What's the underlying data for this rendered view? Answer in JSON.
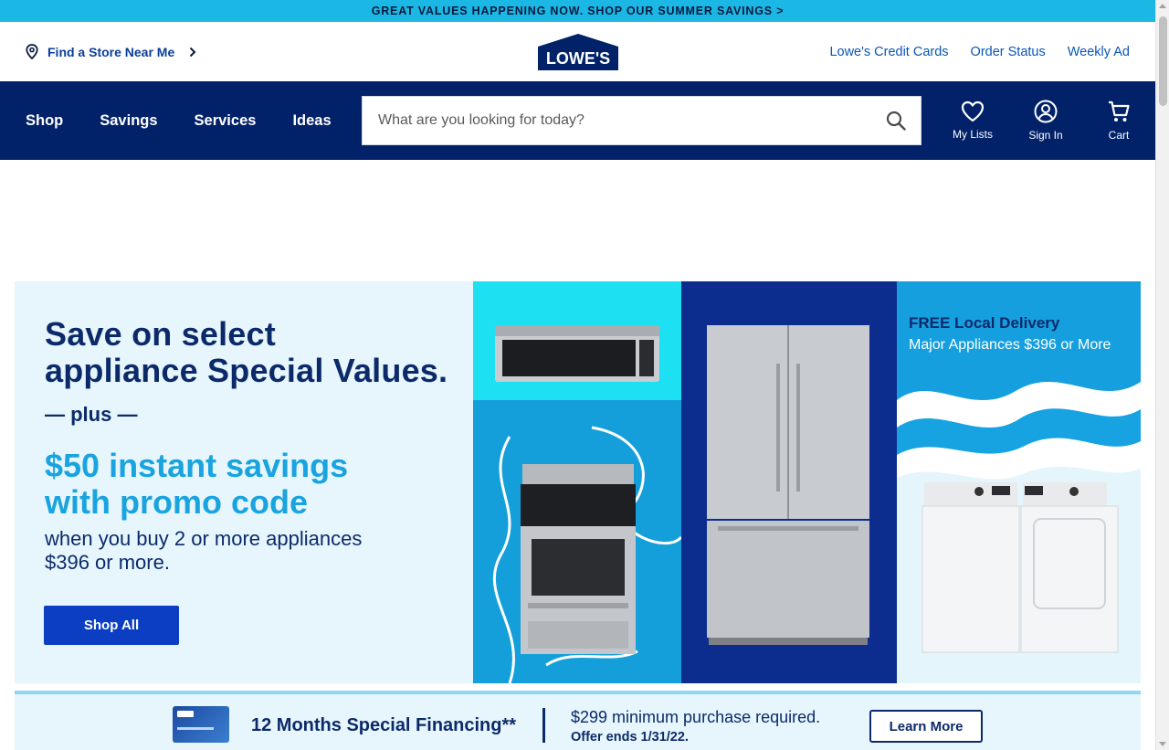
{
  "promo_bar": {
    "text": "GREAT VALUES HAPPENING NOW. SHOP OUR SUMMER SAVINGS >"
  },
  "header": {
    "store_link": "Find a Store Near Me",
    "logo_text": "LOWE'S",
    "links": [
      "Lowe's Credit Cards",
      "Order Status",
      "Weekly Ad"
    ]
  },
  "nav": {
    "menu": [
      "Shop",
      "Savings",
      "Services",
      "Ideas"
    ],
    "search_placeholder": "What are you looking for today?",
    "icons": [
      {
        "label": "My Lists",
        "icon": "heart-icon"
      },
      {
        "label": "Sign In",
        "icon": "user-icon"
      },
      {
        "label": "Cart",
        "icon": "cart-icon"
      }
    ]
  },
  "hero": {
    "title_line1": "Save on select",
    "title_line2": "appliance Special Values.",
    "plus": "— plus —",
    "savings_line1": "$50 instant savings",
    "savings_line2": "with promo code",
    "sub_line1": "when you buy 2 or more appliances",
    "sub_line2": "$396 or more.",
    "cta": "Shop All",
    "delivery_title": "FREE Local Delivery",
    "delivery_sub": "Major Appliances $396 or More"
  },
  "finance": {
    "title": "12 Months Special Financing**",
    "requirement": "$299 minimum purchase required.",
    "offer_ends": "Offer ends 1/31/22.",
    "cta": "Learn More"
  },
  "colors": {
    "promo_bar": "#1bb8e6",
    "nav_bg": "#012169",
    "brand_blue": "#0c2a6a",
    "accent_cyan": "#19a4e0",
    "cta_blue": "#0b3ec3"
  }
}
